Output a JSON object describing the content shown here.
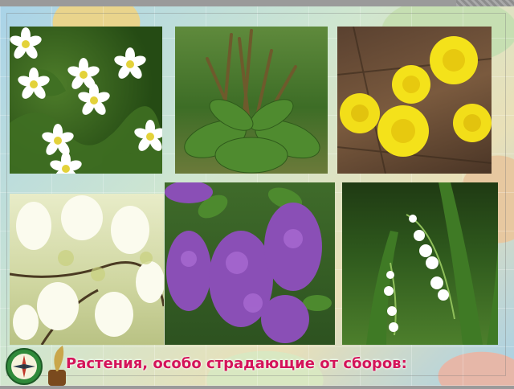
{
  "slide": {
    "caption": "Растения, особо страдающие от сборов:",
    "caption_color": "#d4145a"
  },
  "photos": [
    {
      "subject": "white anemone flowers"
    },
    {
      "subject": "plantain"
    },
    {
      "subject": "coltsfoot flowers"
    },
    {
      "subject": "bird cherry blossom"
    },
    {
      "subject": "lilac"
    },
    {
      "subject": "lily of the valley"
    }
  ],
  "decorations": [
    "compass-icon",
    "quill-icon"
  ]
}
